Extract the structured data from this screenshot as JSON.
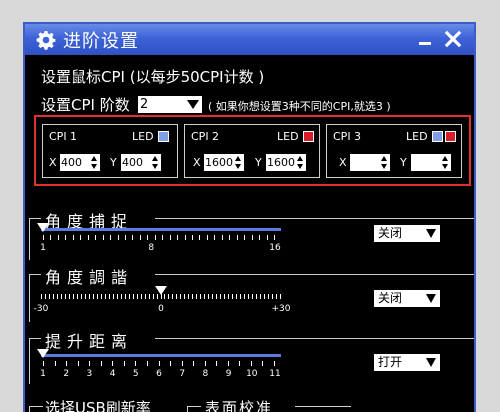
{
  "window": {
    "title": "进阶设置"
  },
  "cpi": {
    "heading": "设置鼠标CPI (以每步50CPI计数 )",
    "levels_label": "设置CPI 阶数",
    "levels_value": "2",
    "note": "( 如果你想设置3种不同的CPI,就选3 )",
    "led_label": "LED",
    "x_label": "X",
    "y_label": "Y",
    "cards": [
      {
        "title": "CPI 1",
        "x": "400",
        "y": "400",
        "led_colors": [
          "#7f9ee6"
        ]
      },
      {
        "title": "CPI 2",
        "x": "1600",
        "y": "1600",
        "led_colors": [
          "#d41f2a"
        ]
      },
      {
        "title": "CPI 3",
        "x": "",
        "y": "",
        "led_colors": [
          "#7f9ee6",
          "#d41f2a"
        ]
      }
    ]
  },
  "angle_snap": {
    "title": "角度捕捉",
    "value": 1,
    "min": 1,
    "max": 16,
    "labels": [
      "1",
      "8",
      "16"
    ],
    "dropdown": "关闭"
  },
  "angle_tune": {
    "title": "角度調諧",
    "value": 0,
    "min": -30,
    "max": 30,
    "labels": [
      "-30",
      "0",
      "+30"
    ],
    "dropdown": "关闭"
  },
  "lift_distance": {
    "title": "提升距离",
    "value": 1,
    "min": 1,
    "max": 11,
    "labels": [
      "1",
      "2",
      "3",
      "4",
      "5",
      "6",
      "7",
      "8",
      "9",
      "10",
      "11"
    ],
    "dropdown": "打开"
  },
  "bottom": {
    "usb_title": "选择USB刷新率",
    "surface_title": "表面校准"
  },
  "colors": {
    "accent": "#3c63d8",
    "highlight": "#e03030",
    "track": "#5b7be0"
  }
}
